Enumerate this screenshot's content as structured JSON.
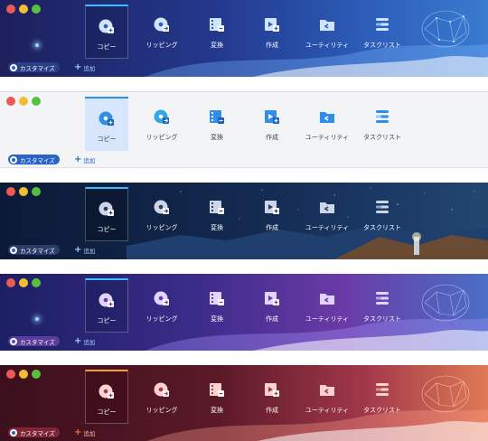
{
  "customize_label": "カスタマイズ",
  "add_label": "追加",
  "tabs": [
    {
      "label": "コピー",
      "icon": "disc-copy-icon"
    },
    {
      "label": "リッピング",
      "icon": "disc-rip-icon"
    },
    {
      "label": "変換",
      "icon": "film-convert-icon"
    },
    {
      "label": "作成",
      "icon": "video-create-icon"
    },
    {
      "label": "ユーティリティ",
      "icon": "folder-utility-icon"
    },
    {
      "label": "タスクリスト",
      "icon": "task-list-icon"
    }
  ],
  "themes": [
    {
      "name": "blue",
      "accent": "#35c0ff"
    },
    {
      "name": "light",
      "accent": "#2f8fe8"
    },
    {
      "name": "night",
      "accent": "#35c0ff"
    },
    {
      "name": "purple",
      "accent": "#35c0ff"
    },
    {
      "name": "red",
      "accent": "#f2a22c"
    }
  ]
}
